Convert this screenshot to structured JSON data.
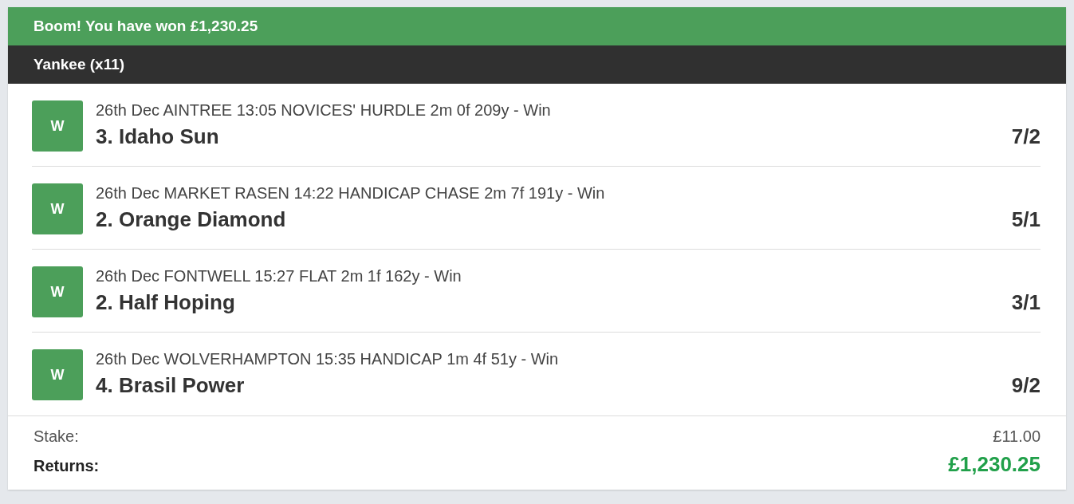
{
  "banner": {
    "title": "Boom! You have won £1,230.25"
  },
  "bet": {
    "title": "Yankee (x11)"
  },
  "selections": [
    {
      "result": "W",
      "event": "26th Dec AINTREE 13:05 NOVICES' HURDLE 2m 0f 209y - Win",
      "runner": "3. Idaho Sun",
      "odds": "7/2"
    },
    {
      "result": "W",
      "event": "26th Dec MARKET RASEN 14:22 HANDICAP CHASE 2m 7f 191y - Win",
      "runner": "2. Orange Diamond",
      "odds": "5/1"
    },
    {
      "result": "W",
      "event": "26th Dec FONTWELL 15:27 FLAT 2m 1f 162y - Win",
      "runner": "2. Half Hoping",
      "odds": "3/1"
    },
    {
      "result": "W",
      "event": "26th Dec WOLVERHAMPTON 15:35 HANDICAP 1m 4f 51y - Win",
      "runner": "4. Brasil Power",
      "odds": "9/2"
    }
  ],
  "summary": {
    "stake_label": "Stake:",
    "stake": "£11.00",
    "returns_label": "Returns:",
    "returns": "£1,230.25"
  }
}
